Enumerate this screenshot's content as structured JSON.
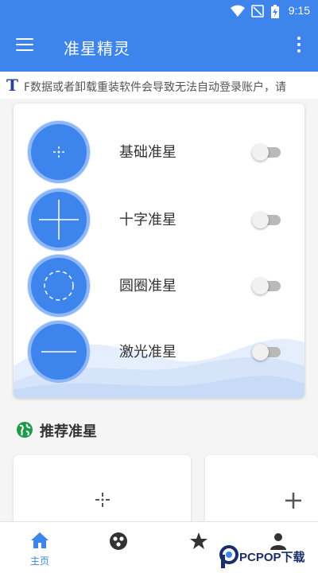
{
  "status_bar": {
    "time": "9:15",
    "icons": [
      "wifi-icon",
      "signal-off-icon",
      "battery-charging-icon"
    ]
  },
  "app_bar": {
    "title": "准星精灵",
    "menu_icon": "menu-icon",
    "more_icon": "more-vert-icon"
  },
  "notice": {
    "icon_letter": "T",
    "text": "F数据或者卸载重装软件会导致无法自动登录账户，请"
  },
  "crosshairs": [
    {
      "label": "基础准星",
      "icon": "dot-crosshair-icon",
      "enabled": false
    },
    {
      "label": "十字准星",
      "icon": "cross-crosshair-icon",
      "enabled": false
    },
    {
      "label": "圆圈准星",
      "icon": "circle-crosshair-icon",
      "enabled": false
    },
    {
      "label": "激光准星",
      "icon": "laser-crosshair-icon",
      "enabled": false
    }
  ],
  "recommend": {
    "title": "推荐准星",
    "icon": "globe-icon"
  },
  "bottom_nav": [
    {
      "label": "主页",
      "icon": "home-icon",
      "active": true
    },
    {
      "label": "",
      "icon": "palette-icon",
      "active": false
    },
    {
      "label": "",
      "icon": "star-icon",
      "active": false
    },
    {
      "label": "",
      "icon": "person-icon",
      "active": false
    }
  ],
  "watermark": {
    "text": "PCPOP下载"
  },
  "colors": {
    "primary": "#3d84ec",
    "circle_ring": "#8fb7f6",
    "notice_icon": "#27439a"
  }
}
